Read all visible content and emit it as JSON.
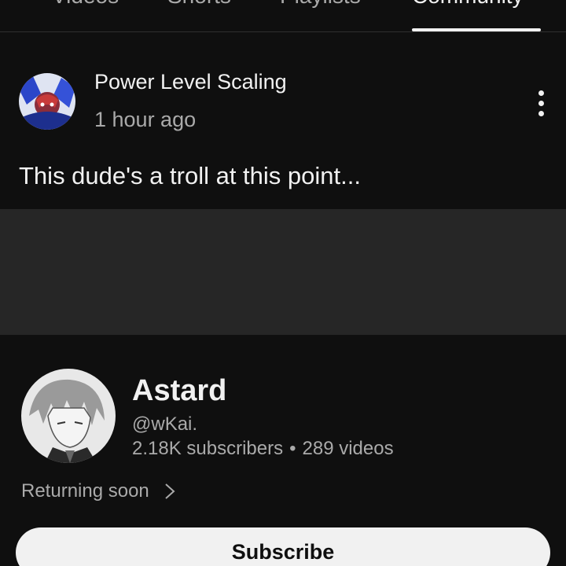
{
  "tabs": [
    {
      "label": "Videos"
    },
    {
      "label": "Shorts"
    },
    {
      "label": "Playlists"
    },
    {
      "label": "Community",
      "active": true
    }
  ],
  "post": {
    "channel": "Power Level Scaling",
    "time": "1 hour ago",
    "text": "This dude's a troll at this point..."
  },
  "channel": {
    "name": "Astard",
    "handle": "@wKai.",
    "subscribers": "2.18K subscribers",
    "separator": "•",
    "videos": "289 videos",
    "returning": "Returning soon",
    "subscribe_label": "Subscribe"
  },
  "colors": {
    "background": "#0f0f0f",
    "media_block": "#262626",
    "text_primary": "#f1f1f1",
    "text_secondary": "#aaaaaa",
    "button_bg": "#f1f1f1"
  }
}
